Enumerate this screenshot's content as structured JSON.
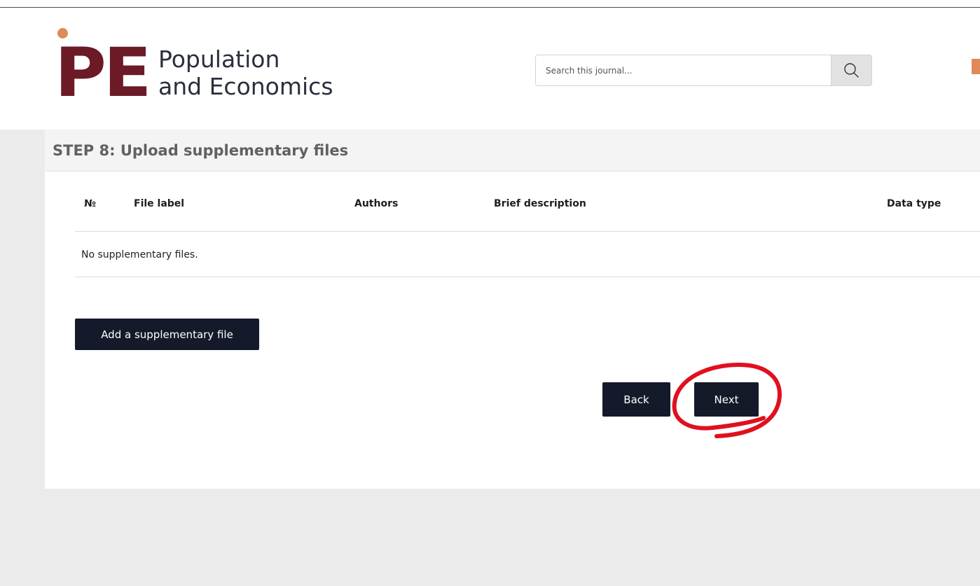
{
  "header": {
    "logo_mark": "PE",
    "logo_line1": "Population",
    "logo_line2": "and Economics",
    "search": {
      "placeholder": "Search this journal..."
    },
    "icons": {
      "search": "search-icon"
    }
  },
  "step": {
    "title": "STEP 8: Upload supplementary files"
  },
  "table": {
    "columns": [
      "№",
      "File label",
      "Authors",
      "Brief description",
      "Data type"
    ],
    "empty_message": "No supplementary files."
  },
  "actions": {
    "add_label": "Add a supplementary file",
    "back_label": "Back",
    "next_label": "Next"
  },
  "colors": {
    "brand": "#6b1a26",
    "accent": "#e08a5a",
    "button": "#151a2a",
    "annotation": "#e0101e"
  }
}
